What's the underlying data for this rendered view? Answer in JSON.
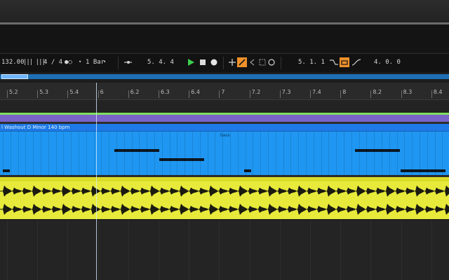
{
  "transport": {
    "tempo": "132.00",
    "tap_icon": "|||| |||",
    "signature": "4 / 4",
    "metronome": "●○",
    "quantize": "1 Bar",
    "arrangement_position": "5.   4.   4",
    "loop_start": "5.   1.   1",
    "loop_length": "4.   0.   0"
  },
  "ruler": {
    "ticks": [
      "5.2",
      "5.3",
      "5.4",
      "6",
      "6.2",
      "6.3",
      "6.4",
      "7",
      "7.2",
      "7.3",
      "7.4",
      "8",
      "8.2",
      "8.3",
      "8.4"
    ]
  },
  "tracks": {
    "midi_clip_title": "l Washout D Minor 140 bpm",
    "midi_clip_name": "bass"
  },
  "colors": {
    "midi_clip": "#1f97f2",
    "audio_clip": "#e7ea3a",
    "accent_orange": "#f0912a",
    "play_green": "#3ccf4e"
  },
  "icons": [
    "tap-tempo-icon",
    "metronome-icon",
    "dropdown-icon",
    "follow-icon",
    "play-icon",
    "stop-icon",
    "record-icon",
    "add-icon",
    "draw-mode-icon",
    "back-icon",
    "loop-region-icon",
    "overdub-icon",
    "automation-icon",
    "loop-icon",
    "curve-icon"
  ]
}
